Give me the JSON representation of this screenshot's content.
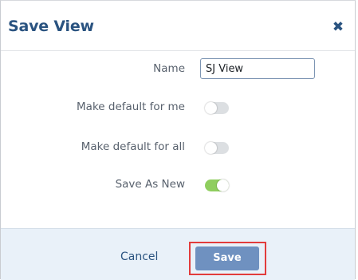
{
  "dialog": {
    "title": "Save View",
    "close_icon": "close-icon",
    "close_glyph": "✖"
  },
  "form": {
    "name": {
      "label": "Name",
      "value": "SJ View"
    },
    "make_default_for_me": {
      "label": "Make default for me",
      "on": false
    },
    "make_default_for_all": {
      "label": "Make default for all",
      "on": false
    },
    "save_as_new": {
      "label": "Save As New",
      "on": true
    }
  },
  "footer": {
    "cancel_label": "Cancel",
    "save_label": "Save"
  },
  "colors": {
    "title": "#2a5380",
    "toggle_on": "#8fce5e",
    "toggle_off": "#dcdfe2",
    "save_button": "#6f91c0",
    "footer_bg": "#e9f1f9",
    "highlight": "#e23c3c"
  }
}
